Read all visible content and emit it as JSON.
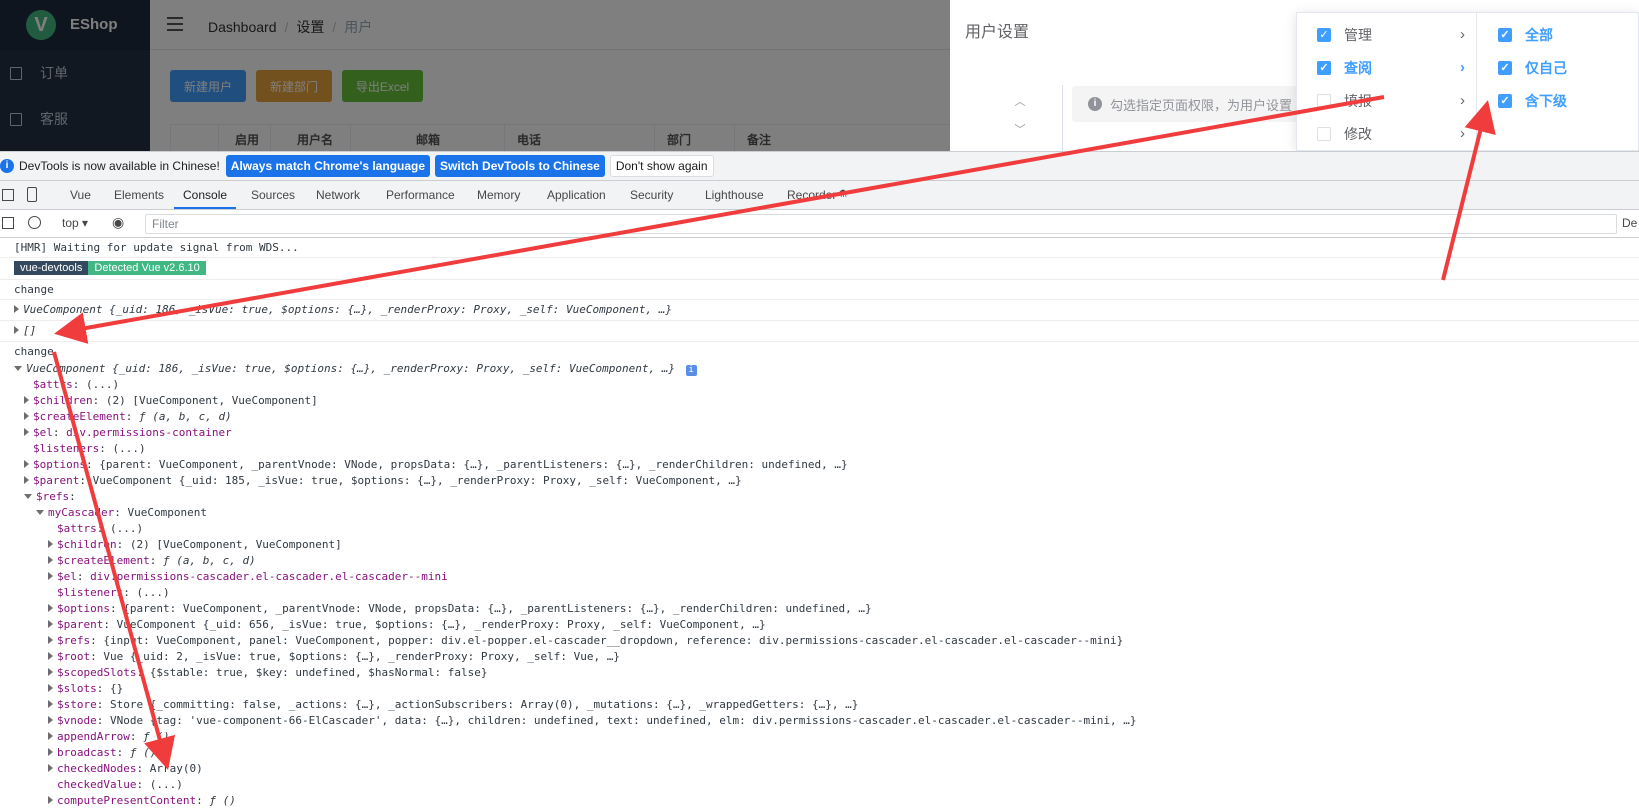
{
  "app": {
    "brand": "EShop",
    "logo_letter": "V"
  },
  "sidebar": {
    "items": [
      {
        "label": "订单",
        "icon": "document-icon"
      },
      {
        "label": "客服",
        "icon": "document-icon"
      }
    ]
  },
  "header": {
    "breadcrumb": [
      "Dashboard",
      "设置",
      "用户"
    ]
  },
  "toolbar_buttons": [
    {
      "label": "新建用户",
      "color": "#409eff"
    },
    {
      "label": "新建部门",
      "color": "#e6a23c"
    },
    {
      "label": "导出Excel",
      "color": "#67c23a"
    }
  ],
  "table": {
    "columns": [
      "",
      "启用",
      "用户名",
      "邮箱",
      "电话",
      "部门",
      "备注"
    ]
  },
  "drawer": {
    "title": "用户设置",
    "tip": "勾选指定页面权限，为用户设置"
  },
  "cascader": {
    "col1": [
      {
        "label": "管理",
        "checked": true,
        "active": false
      },
      {
        "label": "查阅",
        "checked": true,
        "active": true
      },
      {
        "label": "填报",
        "checked": false,
        "active": false
      },
      {
        "label": "修改",
        "checked": false,
        "active": false
      }
    ],
    "col2": [
      {
        "label": "全部",
        "checked": true
      },
      {
        "label": "仅自己",
        "checked": true
      },
      {
        "label": "含下级",
        "checked": true
      }
    ]
  },
  "devtools": {
    "infobar": {
      "text": "DevTools is now available in Chinese!",
      "btn1": "Always match Chrome's language",
      "btn2": "Switch DevTools to Chinese",
      "btn3": "Don't show again"
    },
    "tabs": [
      "Vue",
      "Elements",
      "Console",
      "Sources",
      "Network",
      "Performance",
      "Memory",
      "Application",
      "Security",
      "Lighthouse",
      "Recorder"
    ],
    "selected_tab": "Console",
    "context": "top",
    "filter_placeholder": "Filter",
    "right_cut": "De"
  },
  "console": {
    "hmr": "[HMR] Waiting for update signal from WDS...",
    "badge_left": "vue-devtools",
    "badge_right": "Detected Vue v2.6.10",
    "change1": "change",
    "obj1": "VueComponent {_uid: 186, _isVue: true, $options: {…}, _renderProxy: Proxy, _self: VueComponent, …}",
    "arr": "[]",
    "change2": "change",
    "obj2": "VueComponent {_uid: 186, _isVue: true, $options: {…}, _renderProxy: Proxy, _self: VueComponent, …}",
    "info_icon": "i"
  },
  "tree": [
    {
      "indent": 0,
      "tri": "none",
      "key": "$attrs",
      "rest": "(...)"
    },
    {
      "indent": 0,
      "tri": "closed",
      "key": "$children",
      "rest": "(2) [VueComponent, VueComponent]"
    },
    {
      "indent": 0,
      "tri": "closed",
      "key": "$createElement",
      "rest": "ƒ (a, b, c, d)"
    },
    {
      "indent": 0,
      "tri": "closed",
      "key": "$el",
      "rest": "div.permissions-container"
    },
    {
      "indent": 0,
      "tri": "none",
      "key": "$listeners",
      "rest": "(...)"
    },
    {
      "indent": 0,
      "tri": "closed",
      "key": "$options",
      "rest": "{parent: VueComponent, _parentVnode: VNode, propsData: {…}, _parentListeners: {…}, _renderChildren: undefined, …}"
    },
    {
      "indent": 0,
      "tri": "closed",
      "key": "$parent",
      "rest": "VueComponent {_uid: 185, _isVue: true, $options: {…}, _renderProxy: Proxy, _self: VueComponent, …}"
    },
    {
      "indent": 0,
      "tri": "open",
      "key": "$refs",
      "rest": ""
    },
    {
      "indent": 1,
      "tri": "open",
      "key": "myCascader",
      "rest": "VueComponent"
    },
    {
      "indent": 2,
      "tri": "none",
      "key": "$attrs",
      "rest": "(...)"
    },
    {
      "indent": 2,
      "tri": "closed",
      "key": "$children",
      "rest": "(2) [VueComponent, VueComponent]"
    },
    {
      "indent": 2,
      "tri": "closed",
      "key": "$createElement",
      "rest": "ƒ (a, b, c, d)"
    },
    {
      "indent": 2,
      "tri": "closed",
      "key": "$el",
      "rest": "div.permissions-cascader.el-cascader.el-cascader--mini"
    },
    {
      "indent": 2,
      "tri": "none",
      "key": "$listeners",
      "rest": "(...)"
    },
    {
      "indent": 2,
      "tri": "closed",
      "key": "$options",
      "rest": "{parent: VueComponent, _parentVnode: VNode, propsData: {…}, _parentListeners: {…}, _renderChildren: undefined, …}"
    },
    {
      "indent": 2,
      "tri": "closed",
      "key": "$parent",
      "rest": "VueComponent {_uid: 656, _isVue: true, $options: {…}, _renderProxy: Proxy, _self: VueComponent, …}"
    },
    {
      "indent": 2,
      "tri": "closed",
      "key": "$refs",
      "rest": "{input: VueComponent, panel: VueComponent, popper: div.el-popper.el-cascader__dropdown, reference: div.permissions-cascader.el-cascader.el-cascader--mini}"
    },
    {
      "indent": 2,
      "tri": "closed",
      "key": "$root",
      "rest": "Vue {_uid: 2, _isVue: true, $options: {…}, _renderProxy: Proxy, _self: Vue, …}"
    },
    {
      "indent": 2,
      "tri": "closed",
      "key": "$scopedSlots",
      "rest": "{$stable: true, $key: undefined, $hasNormal: false}"
    },
    {
      "indent": 2,
      "tri": "closed",
      "key": "$slots",
      "rest": "{}"
    },
    {
      "indent": 2,
      "tri": "closed",
      "key": "$store",
      "rest": "Store {_committing: false, _actions: {…}, _actionSubscribers: Array(0), _mutations: {…}, _wrappedGetters: {…}, …}"
    },
    {
      "indent": 2,
      "tri": "closed",
      "key": "$vnode",
      "rest": "VNode {tag: 'vue-component-66-ElCascader', data: {…}, children: undefined, text: undefined, elm: div.permissions-cascader.el-cascader.el-cascader--mini, …}"
    },
    {
      "indent": 2,
      "tri": "closed",
      "key": "appendArrow",
      "rest": "ƒ ()"
    },
    {
      "indent": 2,
      "tri": "closed",
      "key": "broadcast",
      "rest": "ƒ ()"
    },
    {
      "indent": 2,
      "tri": "closed",
      "key": "checkedNodes",
      "rest": "Array(0)"
    },
    {
      "indent": 2,
      "tri": "none",
      "key": "checkedValue",
      "rest": "(...)"
    },
    {
      "indent": 2,
      "tri": "closed",
      "key": "computePresentContent",
      "rest": "ƒ ()"
    }
  ],
  "colors": {
    "accent": "#409eff",
    "arrow": "#f03c3c",
    "devtools_blue": "#1a73e8",
    "sidebar_bg": "#233045"
  }
}
